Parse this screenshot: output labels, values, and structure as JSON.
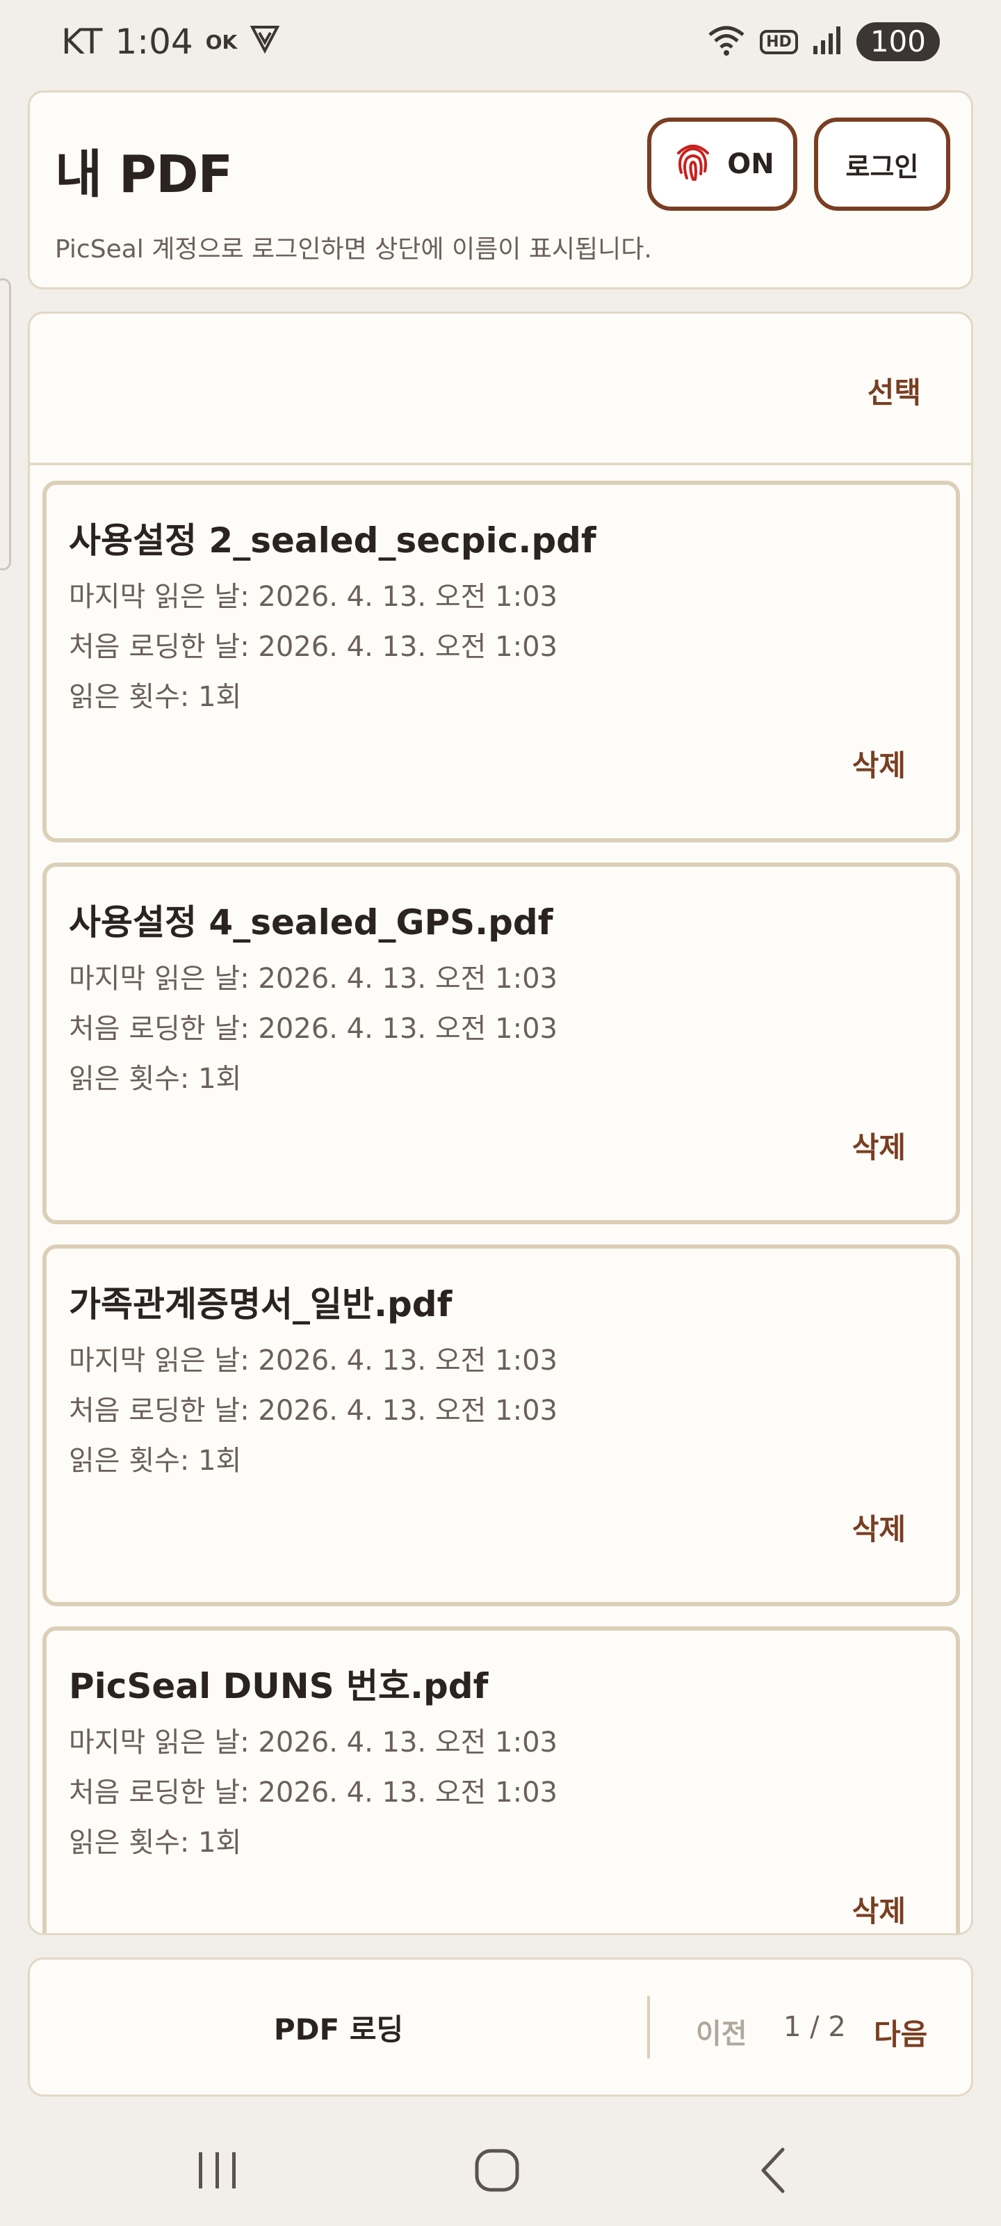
{
  "status_bar": {
    "carrier": "KT",
    "time": "1:04",
    "battery": "100",
    "network_badge": "HD",
    "icons": [
      "ok-status-icon",
      "shield-v-icon",
      "wifi-icon",
      "hd-voice-icon",
      "signal-icon",
      "battery-icon"
    ]
  },
  "header": {
    "title": "내 PDF",
    "subtitle": "PicSeal 계정으로 로그인하면 상단에 이름이 표시됩니다.",
    "fingerprint_toggle_label": "ON",
    "login_label": "로그인",
    "accent_color": "#7a3e22",
    "fingerprint_color": "#c8201e"
  },
  "list": {
    "select_label": "선택",
    "items": [
      {
        "name": "사용설정 2_sealed_secpic.pdf",
        "last_read": "마지막 읽은 날: 2026. 4. 13. 오전 1:03",
        "first_loaded": "처음 로딩한 날: 2026. 4. 13. 오전 1:03",
        "read_count": "읽은 횟수: 1회",
        "delete_label": "삭제"
      },
      {
        "name": "사용설정 4_sealed_GPS.pdf",
        "last_read": "마지막 읽은 날: 2026. 4. 13. 오전 1:03",
        "first_loaded": "처음 로딩한 날: 2026. 4. 13. 오전 1:03",
        "read_count": "읽은 횟수: 1회",
        "delete_label": "삭제"
      },
      {
        "name": "가족관계증명서_일반.pdf",
        "last_read": "마지막 읽은 날: 2026. 4. 13. 오전 1:03",
        "first_loaded": "처음 로딩한 날: 2026. 4. 13. 오전 1:03",
        "read_count": "읽은 횟수: 1회",
        "delete_label": "삭제"
      },
      {
        "name": "PicSeal DUNS 번호.pdf",
        "last_read": "마지막 읽은 날: 2026. 4. 13. 오전 1:03",
        "first_loaded": "처음 로딩한 날: 2026. 4. 13. 오전 1:03",
        "read_count": "읽은 횟수: 1회",
        "delete_label": "삭제"
      }
    ]
  },
  "bottom_bar": {
    "load_label": "PDF 로딩",
    "prev_label": "이전",
    "page_indicator": "1 / 2",
    "next_label": "다음"
  },
  "nav_bar": {
    "buttons": [
      "recents-icon",
      "home-icon",
      "back-icon"
    ]
  }
}
